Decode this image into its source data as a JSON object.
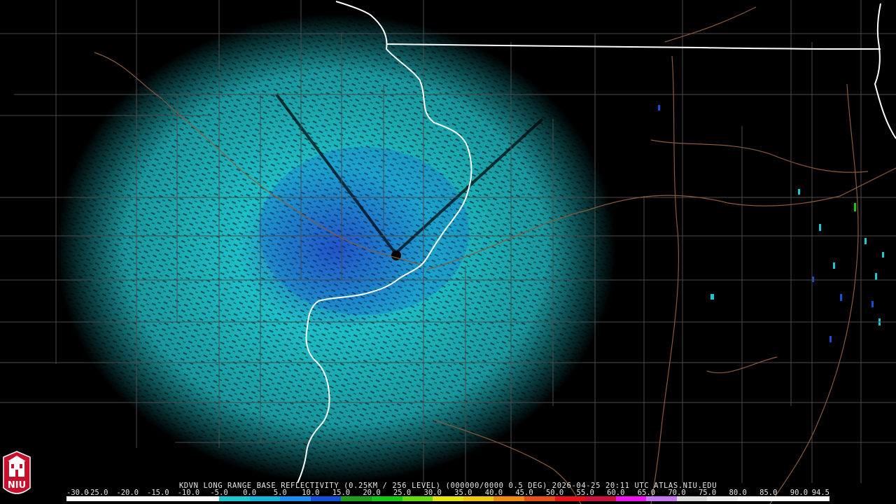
{
  "caption": "KDVN LONG RANGE BASE REFLECTIVITY (0.25KM / 256 LEVEL) (000000/0000 0.5 DEG) 2026-04-25 20:11 UTC  ATLAS.NIU.EDU",
  "scale": {
    "ticks": [
      "-30.0",
      "-25.0",
      "-20.0",
      "-15.0",
      "-10.0",
      "-5.0",
      "0.0",
      "5.0",
      "10.0",
      "15.0",
      "20.0",
      "25.0",
      "30.0",
      "35.0",
      "40.0",
      "45.0",
      "50.0",
      "55.0",
      "60.0",
      "65.0",
      "70.0",
      "75.0",
      "80.0",
      "85.0",
      "90.0",
      "94.5"
    ],
    "colors": [
      "#000000",
      "#000000",
      "#000000",
      "#000000",
      "#000000",
      "#1ec8d2",
      "#16b4dc",
      "#1e8cf0",
      "#1450dc",
      "#1ea01e",
      "#14c814",
      "#64dc14",
      "#e6e614",
      "#f0c814",
      "#f08c14",
      "#e65014",
      "#e61414",
      "#c8143c",
      "#f014f0",
      "#c878f0",
      "#dcdcdc",
      "#f0f0f0",
      "#ffffff",
      "#ffffff",
      "#ffffff"
    ]
  },
  "logo": {
    "text": "NIU"
  },
  "colors": {
    "background": "#000000",
    "county_lines": "#4a4a4a",
    "state_lines": "#ffffff",
    "rivers": "#8a5a3a",
    "echo_primary": "#1ec8d2",
    "echo_secondary": "#1450dc"
  },
  "radar": {
    "site": "KDVN"
  }
}
